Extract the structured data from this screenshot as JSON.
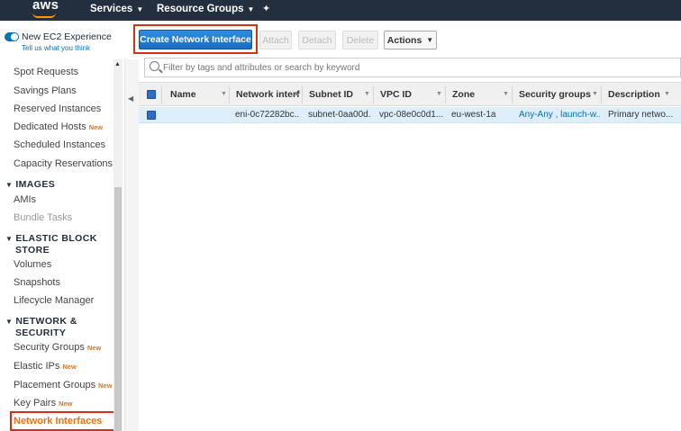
{
  "topbar": {
    "logo": "aws",
    "services": "Services",
    "resource_groups": "Resource Groups"
  },
  "experience": {
    "label": "New EC2 Experience",
    "sub": "Tell us what you think"
  },
  "sidebar": {
    "items_top": [
      "Spot Requests",
      "Savings Plans",
      "Reserved Instances",
      "Dedicated Hosts",
      "Scheduled Instances",
      "Capacity Reservations"
    ],
    "dedicated_new": "New",
    "images_head": "IMAGES",
    "images": [
      "AMIs",
      "Bundle Tasks"
    ],
    "ebs_head_line1": "ELASTIC BLOCK",
    "ebs_head_line2": "STORE",
    "ebs": [
      "Volumes",
      "Snapshots",
      "Lifecycle Manager"
    ],
    "net_head_line1": "NETWORK &",
    "net_head_line2": "SECURITY",
    "net": [
      "Security Groups",
      "Elastic IPs",
      "Placement Groups",
      "Key Pairs",
      "Network Interfaces"
    ],
    "new_badge": "New"
  },
  "toolbar": {
    "create": "Create Network Interface",
    "attach": "Attach",
    "detach": "Detach",
    "delete": "Delete",
    "actions": "Actions"
  },
  "search": {
    "placeholder": "Filter by tags and attributes or search by keyword"
  },
  "table": {
    "headers": [
      "Name",
      "Network interf",
      "Subnet ID",
      "VPC ID",
      "Zone",
      "Security groups",
      "Description"
    ],
    "row": {
      "name": "",
      "eni": "eni-0c72282bc...",
      "subnet": "subnet-0aa00d...",
      "vpc": "vpc-08e0c0d1...",
      "zone": "eu-west-1a",
      "sg": "Any-Any , launch-w...",
      "description": "Primary netwo..."
    }
  },
  "colors": {
    "topbar": "#232f3e",
    "primary": "#1b6cc4",
    "highlight": "#d13212",
    "new_badge": "#ec7211",
    "row_selected": "#deeefb"
  }
}
